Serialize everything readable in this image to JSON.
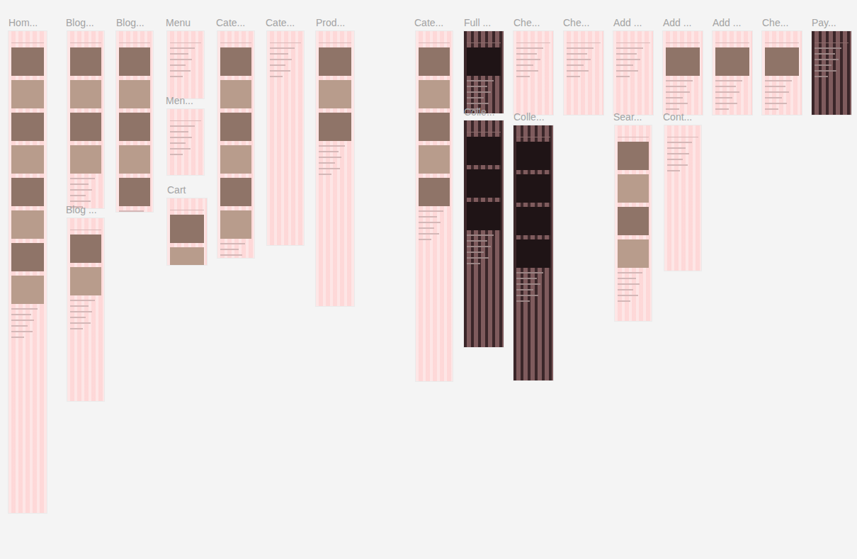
{
  "canvas": {
    "frames": [
      {
        "label": "Hom...",
        "kind": "page"
      },
      {
        "label": "Blog...",
        "kind": "page"
      },
      {
        "label": "Blog...",
        "kind": "page"
      },
      {
        "label": "Menu",
        "kind": "page"
      },
      {
        "label": "Men...",
        "kind": "page"
      },
      {
        "label": "Cart",
        "kind": "page"
      },
      {
        "label": "Blog ...",
        "kind": "page"
      },
      {
        "label": "Cate...",
        "kind": "page"
      },
      {
        "label": "Cate...",
        "kind": "page"
      },
      {
        "label": "Prod...",
        "kind": "page"
      },
      {
        "label": "Cate...",
        "kind": "page"
      },
      {
        "label": "Full ...",
        "kind": "dark"
      },
      {
        "label": "Colle...",
        "kind": "dark"
      },
      {
        "label": "Che...",
        "kind": "page"
      },
      {
        "label": "Colle...",
        "kind": "dark"
      },
      {
        "label": "Che...",
        "kind": "page"
      },
      {
        "label": "Add ...",
        "kind": "page"
      },
      {
        "label": "Sear...",
        "kind": "page"
      },
      {
        "label": "Add ...",
        "kind": "page"
      },
      {
        "label": "Cont...",
        "kind": "page"
      },
      {
        "label": "Add ...",
        "kind": "page"
      },
      {
        "label": "Che...",
        "kind": "page"
      },
      {
        "label": "Pay...",
        "kind": "dark"
      }
    ]
  }
}
